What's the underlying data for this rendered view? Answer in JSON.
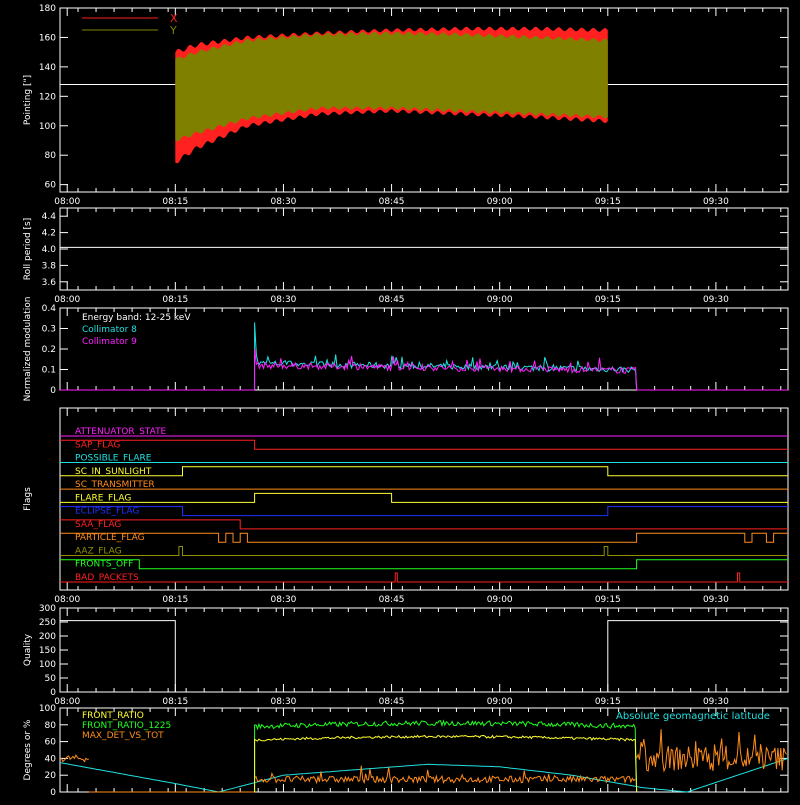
{
  "colors": {
    "background": "#000000",
    "axis": "#ffffff",
    "x_series": "#ff2020",
    "y_series": "#808000",
    "cyan": "#20e0e0",
    "magenta": "#ff20ff",
    "yellow": "#ffff30",
    "green": "#20ff20",
    "orange": "#ff8c1a",
    "blue": "#2030ff",
    "olive": "#909000"
  },
  "time_axis": {
    "range": [
      "07:59",
      "09:40"
    ],
    "tick_labels": [
      "08:00",
      "08:15",
      "08:30",
      "08:45",
      "09:00",
      "09:15",
      "09:30"
    ]
  },
  "chart_data": [
    {
      "type": "line",
      "panel": "pointing",
      "ylabel": "Pointing [\"]",
      "ylim": [
        55,
        180
      ],
      "yticks": [
        "60",
        "80",
        "100",
        "120",
        "140",
        "160",
        "180"
      ],
      "reference_line_y": 128,
      "legend": {
        "placement": "top-left",
        "entries": [
          {
            "name": "X",
            "color": "#ff2020"
          },
          {
            "name": "Y",
            "color": "#808000"
          }
        ]
      },
      "series": [
        {
          "name": "X",
          "time_range": [
            "08:15",
            "09:15"
          ],
          "upper_envelope": [
            [
              0,
              150
            ],
            [
              3,
              155
            ],
            [
              10,
              160
            ],
            [
              20,
              163
            ],
            [
              30,
              165
            ],
            [
              40,
              166
            ],
            [
              50,
              166
            ],
            [
              60,
              165
            ]
          ],
          "lower_envelope": [
            [
              0,
              75
            ],
            [
              3,
              85
            ],
            [
              10,
              100
            ],
            [
              20,
              108
            ],
            [
              30,
              110
            ],
            [
              40,
              108
            ],
            [
              50,
              106
            ],
            [
              60,
              103
            ]
          ]
        },
        {
          "name": "Y",
          "time_range": [
            "08:15",
            "09:15"
          ],
          "upper_envelope": [
            [
              0,
              145
            ],
            [
              3,
              150
            ],
            [
              10,
              158
            ],
            [
              20,
              162
            ],
            [
              30,
              163
            ],
            [
              40,
              162
            ],
            [
              50,
              160
            ],
            [
              60,
              158
            ]
          ],
          "lower_envelope": [
            [
              0,
              90
            ],
            [
              3,
              95
            ],
            [
              10,
              105
            ],
            [
              20,
              112
            ],
            [
              30,
              112
            ],
            [
              40,
              110
            ],
            [
              50,
              108
            ],
            [
              60,
              106
            ]
          ]
        }
      ]
    },
    {
      "type": "line",
      "panel": "roll_period",
      "ylabel": "Roll period [s]",
      "ylim": [
        3.5,
        4.5
      ],
      "yticks": [
        "3.6",
        "3.8",
        "4.0",
        "4.2",
        "4.4"
      ],
      "series": [
        {
          "values_constant": 4.02
        }
      ]
    },
    {
      "type": "line",
      "panel": "modulation",
      "ylabel": "Normalized modulation",
      "ylim": [
        0,
        0.4
      ],
      "yticks": [
        "0",
        "0.1",
        "0.2",
        "0.3",
        "0.4"
      ],
      "legend_title": "Energy band: 12-25 keV",
      "series": [
        {
          "name": "Collimator 8",
          "color": "#20e0e0",
          "time_range": [
            "08:26",
            "09:19"
          ],
          "start_peak": 0.33,
          "level_start": 0.13,
          "level_end": 0.1
        },
        {
          "name": "Collimator 9",
          "color": "#ff20ff",
          "time_range": [
            "08:26",
            "09:19"
          ],
          "start_peak": 0.2,
          "level_start": 0.12,
          "level_end": 0.095
        }
      ]
    },
    {
      "type": "step",
      "panel": "flags",
      "ylabel": "Flags",
      "flags": [
        {
          "name": "ATTENUATOR_STATE",
          "color": "#ff20ff",
          "high": []
        },
        {
          "name": "SAP_FLAG",
          "color": "#ff2020",
          "high": [
            [
              "07:59",
              "08:26"
            ]
          ]
        },
        {
          "name": "POSSIBLE_FLARE",
          "color": "#20e0e0",
          "high": []
        },
        {
          "name": "SC_IN_SUNLIGHT",
          "color": "#ffff30",
          "high": [
            [
              "08:16",
              "09:15"
            ]
          ]
        },
        {
          "name": "SC_TRANSMITTER",
          "color": "#ff8c1a",
          "high": []
        },
        {
          "name": "FLARE_FLAG",
          "color": "#ffff30",
          "high": [
            [
              "08:26",
              "08:45"
            ]
          ]
        },
        {
          "name": "ECLIPSE_FLAG",
          "color": "#2030ff",
          "high": [
            [
              "07:59",
              "08:16"
            ],
            [
              "09:15",
              "09:40"
            ]
          ]
        },
        {
          "name": "SAA_FLAG",
          "color": "#ff2020",
          "high": [
            [
              "07:59",
              "08:24"
            ]
          ]
        },
        {
          "name": "PARTICLE_FLAG",
          "color": "#ff8c1a",
          "high": [
            [
              "07:59",
              "08:21"
            ],
            [
              "08:22",
              "08:23"
            ],
            [
              "08:24",
              "08:25"
            ],
            [
              "09:19",
              "09:34"
            ],
            [
              "09:35",
              "09:37"
            ],
            [
              "09:38",
              "09:40"
            ]
          ]
        },
        {
          "name": "AAZ_FLAG",
          "color": "#909000",
          "high": [
            [
              "08:15.5",
              "08:16"
            ],
            [
              "09:14.5",
              "09:15"
            ]
          ]
        },
        {
          "name": "FRONTS_OFF",
          "color": "#20ff20",
          "high": [
            [
              "07:59",
              "08:10"
            ],
            [
              "09:19",
              "09:40"
            ]
          ]
        },
        {
          "name": "BAD_PACKETS",
          "color": "#ff2020",
          "high": [
            [
              "08:45.5",
              "08:45.8"
            ],
            [
              "09:33",
              "09:33.3"
            ]
          ]
        }
      ]
    },
    {
      "type": "step",
      "panel": "quality",
      "ylabel": "Quality",
      "ylim": [
        0,
        300
      ],
      "yticks": [
        "0",
        "50",
        "100",
        "150",
        "200",
        "250",
        "300"
      ],
      "series": [
        {
          "segments": [
            {
              "range": [
                "07:59",
                "08:15"
              ],
              "value": 255
            },
            {
              "range": [
                "08:15",
                "09:15"
              ],
              "value": 0
            },
            {
              "range": [
                "09:15",
                "09:40"
              ],
              "value": 255
            }
          ]
        }
      ]
    },
    {
      "type": "line",
      "panel": "degrees",
      "ylabel": "Degrees or %",
      "ylim": [
        0,
        100
      ],
      "yticks": [
        "0",
        "20",
        "40",
        "60",
        "80",
        "100"
      ],
      "legend_right": "Absolute geomagnetic latitude",
      "series": [
        {
          "name": "FRONT_RATIO",
          "color": "#ffff30",
          "time_range": [
            "08:26",
            "09:19"
          ],
          "level": 62
        },
        {
          "name": "FRONT_RATIO_1225",
          "color": "#20ff20",
          "time_range": [
            "08:26",
            "09:19"
          ],
          "level": 78
        },
        {
          "name": "MAX_DET_VS_TOT",
          "color": "#ff8c1a",
          "segments": [
            {
              "range": [
                "07:59",
                "08:03"
              ],
              "level": 40
            },
            {
              "range": [
                "08:26",
                "09:19"
              ],
              "level": 15
            },
            {
              "range": [
                "09:19",
                "09:40"
              ],
              "level": 40
            }
          ]
        },
        {
          "name": "Absolute geomagnetic latitude",
          "color": "#20e0e0",
          "points": [
            [
              "07:59",
              35
            ],
            [
              "08:15",
              10
            ],
            [
              "08:21",
              0
            ],
            [
              "08:30",
              20
            ],
            [
              "08:50",
              33
            ],
            [
              "09:00",
              30
            ],
            [
              "09:10",
              20
            ],
            [
              "09:20",
              5
            ],
            [
              "09:26",
              0
            ],
            [
              "09:40",
              40
            ]
          ]
        }
      ]
    }
  ]
}
